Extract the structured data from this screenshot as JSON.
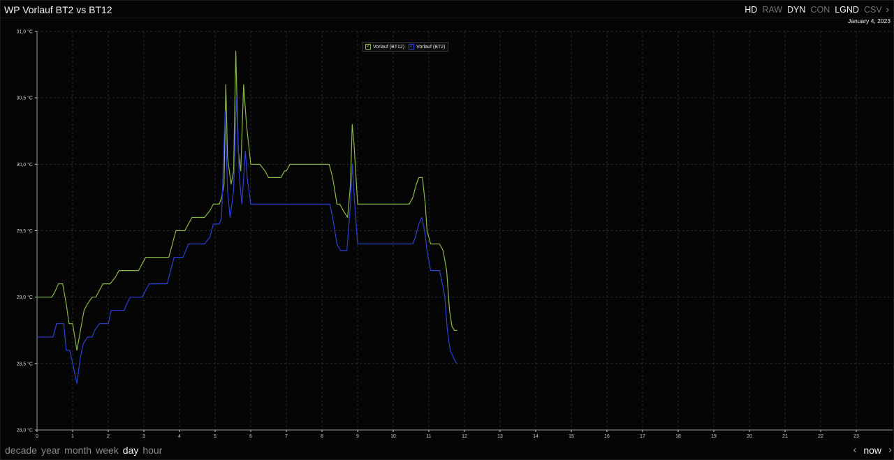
{
  "header": {
    "title": "WP Vorlauf BT2 vs BT12",
    "date": "January 4, 2023",
    "toggles": [
      {
        "label": "HD",
        "on": true
      },
      {
        "label": "RAW",
        "on": false
      },
      {
        "label": "DYN",
        "on": true
      },
      {
        "label": "CON",
        "on": false
      },
      {
        "label": "LGND",
        "on": true
      },
      {
        "label": "CSV",
        "on": false
      }
    ]
  },
  "footer": {
    "ranges": [
      {
        "label": "decade",
        "on": false
      },
      {
        "label": "year",
        "on": false
      },
      {
        "label": "month",
        "on": false
      },
      {
        "label": "week",
        "on": false
      },
      {
        "label": "day",
        "on": true
      },
      {
        "label": "hour",
        "on": false
      }
    ],
    "now_label": "now"
  },
  "colors": {
    "bt12": "#8ab848",
    "bt2": "#2c3fd8",
    "grid": "#2b2b2b",
    "axis": "#cfcfcf"
  },
  "chart_data": {
    "type": "line",
    "xlabel": "",
    "ylabel": "",
    "xlim": [
      0,
      24
    ],
    "ylim": [
      28.0,
      31.0
    ],
    "xticks": [
      0,
      1,
      2,
      3,
      4,
      5,
      6,
      7,
      8,
      9,
      10,
      11,
      12,
      13,
      14,
      15,
      16,
      17,
      18,
      19,
      20,
      21,
      22,
      23
    ],
    "yticks": [
      {
        "value": 28.0,
        "label": "28,0 °C"
      },
      {
        "value": 28.5,
        "label": "28,5 °C"
      },
      {
        "value": 29.0,
        "label": "29,0 °C"
      },
      {
        "value": 29.5,
        "label": "29,5 °C"
      },
      {
        "value": 30.0,
        "label": "30,0 °C"
      },
      {
        "value": 30.5,
        "label": "30,5 °C"
      },
      {
        "value": 31.0,
        "label": "31,0 °C"
      }
    ],
    "grid": true,
    "legend": "top-center",
    "series": [
      {
        "name": "Vorlauf (BT12)",
        "color_key": "bt12",
        "points": [
          [
            0.0,
            29.0
          ],
          [
            0.42,
            29.0
          ],
          [
            0.52,
            29.05
          ],
          [
            0.6,
            29.1
          ],
          [
            0.72,
            29.1
          ],
          [
            0.82,
            28.95
          ],
          [
            0.9,
            28.8
          ],
          [
            1.0,
            28.8
          ],
          [
            1.12,
            28.6
          ],
          [
            1.22,
            28.75
          ],
          [
            1.32,
            28.9
          ],
          [
            1.42,
            28.95
          ],
          [
            1.55,
            29.0
          ],
          [
            1.65,
            29.0
          ],
          [
            1.75,
            29.05
          ],
          [
            1.85,
            29.1
          ],
          [
            2.05,
            29.1
          ],
          [
            2.2,
            29.15
          ],
          [
            2.3,
            29.2
          ],
          [
            2.6,
            29.2
          ],
          [
            2.85,
            29.2
          ],
          [
            2.95,
            29.25
          ],
          [
            3.05,
            29.3
          ],
          [
            3.35,
            29.3
          ],
          [
            3.7,
            29.3
          ],
          [
            3.8,
            29.4
          ],
          [
            3.9,
            29.5
          ],
          [
            4.15,
            29.5
          ],
          [
            4.25,
            29.55
          ],
          [
            4.35,
            29.6
          ],
          [
            4.7,
            29.6
          ],
          [
            4.85,
            29.65
          ],
          [
            4.95,
            29.7
          ],
          [
            5.12,
            29.7
          ],
          [
            5.18,
            29.75
          ],
          [
            5.25,
            29.85
          ],
          [
            5.3,
            30.6
          ],
          [
            5.35,
            30.05
          ],
          [
            5.45,
            29.85
          ],
          [
            5.52,
            29.95
          ],
          [
            5.58,
            30.85
          ],
          [
            5.65,
            30.1
          ],
          [
            5.72,
            29.95
          ],
          [
            5.8,
            30.6
          ],
          [
            5.88,
            30.3
          ],
          [
            6.0,
            30.0
          ],
          [
            6.25,
            30.0
          ],
          [
            6.4,
            29.95
          ],
          [
            6.5,
            29.9
          ],
          [
            6.65,
            29.9
          ],
          [
            6.85,
            29.9
          ],
          [
            6.95,
            29.95
          ],
          [
            7.0,
            29.95
          ],
          [
            7.1,
            30.0
          ],
          [
            7.4,
            30.0
          ],
          [
            8.05,
            30.0
          ],
          [
            8.2,
            30.0
          ],
          [
            8.3,
            29.9
          ],
          [
            8.42,
            29.7
          ],
          [
            8.5,
            29.7
          ],
          [
            8.6,
            29.65
          ],
          [
            8.72,
            29.6
          ],
          [
            8.8,
            29.85
          ],
          [
            8.85,
            30.3
          ],
          [
            8.9,
            30.15
          ],
          [
            9.0,
            29.7
          ],
          [
            9.2,
            29.7
          ],
          [
            9.6,
            29.7
          ],
          [
            10.0,
            29.7
          ],
          [
            10.25,
            29.7
          ],
          [
            10.45,
            29.7
          ],
          [
            10.55,
            29.75
          ],
          [
            10.65,
            29.85
          ],
          [
            10.72,
            29.9
          ],
          [
            10.82,
            29.9
          ],
          [
            10.9,
            29.7
          ],
          [
            10.95,
            29.5
          ],
          [
            11.05,
            29.4
          ],
          [
            11.15,
            29.4
          ],
          [
            11.3,
            29.4
          ],
          [
            11.4,
            29.35
          ],
          [
            11.5,
            29.2
          ],
          [
            11.58,
            28.9
          ],
          [
            11.65,
            28.78
          ],
          [
            11.72,
            28.75
          ],
          [
            11.8,
            28.75
          ]
        ]
      },
      {
        "name": "Vorlauf (BT2)",
        "color_key": "bt2",
        "points": [
          [
            0.0,
            28.7
          ],
          [
            0.45,
            28.7
          ],
          [
            0.55,
            28.8
          ],
          [
            0.75,
            28.8
          ],
          [
            0.82,
            28.6
          ],
          [
            0.92,
            28.6
          ],
          [
            1.0,
            28.5
          ],
          [
            1.12,
            28.35
          ],
          [
            1.22,
            28.55
          ],
          [
            1.3,
            28.65
          ],
          [
            1.42,
            28.7
          ],
          [
            1.55,
            28.7
          ],
          [
            1.62,
            28.75
          ],
          [
            1.75,
            28.8
          ],
          [
            1.9,
            28.8
          ],
          [
            2.0,
            28.8
          ],
          [
            2.08,
            28.9
          ],
          [
            2.2,
            28.9
          ],
          [
            2.45,
            28.9
          ],
          [
            2.52,
            28.95
          ],
          [
            2.62,
            29.0
          ],
          [
            2.95,
            29.0
          ],
          [
            3.05,
            29.05
          ],
          [
            3.15,
            29.1
          ],
          [
            3.65,
            29.1
          ],
          [
            3.75,
            29.2
          ],
          [
            3.85,
            29.3
          ],
          [
            4.1,
            29.3
          ],
          [
            4.25,
            29.4
          ],
          [
            4.35,
            29.4
          ],
          [
            4.7,
            29.4
          ],
          [
            4.85,
            29.45
          ],
          [
            4.95,
            29.55
          ],
          [
            5.12,
            29.55
          ],
          [
            5.18,
            29.6
          ],
          [
            5.28,
            30.4
          ],
          [
            5.35,
            29.8
          ],
          [
            5.42,
            29.6
          ],
          [
            5.52,
            29.8
          ],
          [
            5.6,
            30.5
          ],
          [
            5.68,
            29.9
          ],
          [
            5.75,
            29.7
          ],
          [
            5.85,
            30.1
          ],
          [
            5.9,
            29.9
          ],
          [
            6.0,
            29.7
          ],
          [
            6.25,
            29.7
          ],
          [
            7.0,
            29.7
          ],
          [
            8.0,
            29.7
          ],
          [
            8.22,
            29.7
          ],
          [
            8.3,
            29.6
          ],
          [
            8.42,
            29.4
          ],
          [
            8.52,
            29.35
          ],
          [
            8.6,
            29.35
          ],
          [
            8.7,
            29.35
          ],
          [
            8.8,
            29.7
          ],
          [
            8.85,
            30.0
          ],
          [
            8.92,
            29.7
          ],
          [
            9.0,
            29.4
          ],
          [
            9.25,
            29.4
          ],
          [
            9.6,
            29.4
          ],
          [
            10.0,
            29.4
          ],
          [
            10.3,
            29.4
          ],
          [
            10.55,
            29.4
          ],
          [
            10.62,
            29.45
          ],
          [
            10.72,
            29.55
          ],
          [
            10.8,
            29.6
          ],
          [
            10.88,
            29.5
          ],
          [
            10.95,
            29.35
          ],
          [
            11.05,
            29.2
          ],
          [
            11.15,
            29.2
          ],
          [
            11.3,
            29.2
          ],
          [
            11.38,
            29.1
          ],
          [
            11.45,
            29.0
          ],
          [
            11.52,
            28.75
          ],
          [
            11.6,
            28.6
          ],
          [
            11.68,
            28.55
          ],
          [
            11.78,
            28.5
          ]
        ]
      }
    ]
  }
}
